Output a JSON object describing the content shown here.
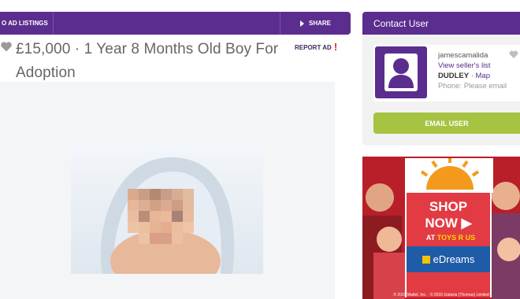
{
  "topbar": {
    "back_label": "O AD LISTINGS",
    "share_label": "SHARE"
  },
  "listing": {
    "title": "£15,000 · 1 Year 8 Months Old Boy For Adoption",
    "report_label": "REPORT AD",
    "report_mark": "!"
  },
  "contact": {
    "header": "Contact User",
    "username": "jamescamalida",
    "sellers_list": "View seller's list",
    "location": "DUDLEY",
    "map_sep": " · ",
    "map_label": "Map",
    "phone": "Phone: Please email",
    "email_button": "EMAIL USER"
  },
  "ad": {
    "headline_1": "SHOP",
    "headline_2": "NOW",
    "at_label": "AT",
    "brand": "TOYS R US",
    "partner": "eDreams",
    "footer": "© 2015 Mattel, Inc. · © 2015 Galaxia (Thomas) Limited"
  },
  "colors": {
    "brand_purple": "#5b2d8e",
    "email_green": "#a6c341",
    "report_red": "#e02626",
    "ad_red": "#c8232b",
    "edreams_blue": "#1f5ca8"
  },
  "icons": [
    "heart-icon",
    "share-arrow-icon",
    "user-avatar-icon",
    "favorite-heart-icon",
    "exclamation-icon"
  ]
}
